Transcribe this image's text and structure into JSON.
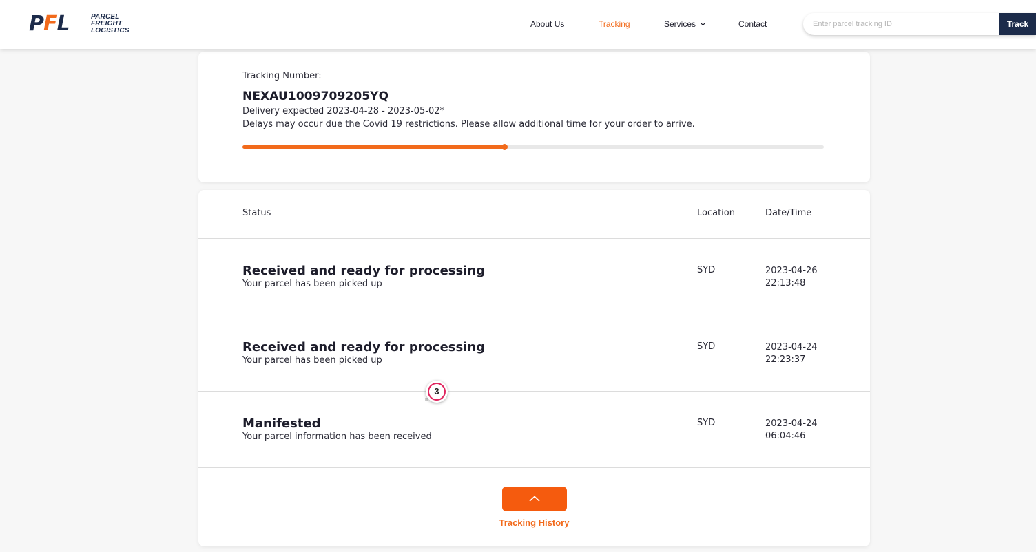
{
  "brand": {
    "logo_mark": "PFL",
    "logo_lines": [
      "PARCEL",
      "FREIGHT",
      "LOGISTICS"
    ],
    "accent_color": "#f26a1b",
    "navy_color": "#1c2b4a"
  },
  "nav": {
    "about": "About Us",
    "tracking": "Tracking",
    "services": "Services",
    "contact": "Contact",
    "active": "Tracking"
  },
  "search": {
    "placeholder": "Enter parcel tracking ID",
    "value": "",
    "button_label": "Track"
  },
  "summary": {
    "tracking_label": "Tracking Number:",
    "tracking_number": "NEXAU1009709205YQ",
    "expected": "Delivery expected 2023-04-28 - 2023-05-02*",
    "delay_notice": "Delays may occur due the Covid 19 restrictions. Please allow additional time for your order to arrive.",
    "progress_fraction": 0.45
  },
  "table": {
    "headers": {
      "status": "Status",
      "location": "Location",
      "datetime": "Date/Time"
    },
    "rows": [
      {
        "title": "Received and ready for processing",
        "subtitle": "Your parcel has been picked up",
        "location": "SYD",
        "date": "2023-04-26",
        "time": "22:13:48"
      },
      {
        "title": "Received and ready for processing",
        "subtitle": "Your parcel has been picked up",
        "location": "SYD",
        "date": "2023-04-24",
        "time": "22:23:37"
      },
      {
        "title": "Manifested",
        "subtitle": "Your parcel information has been received",
        "location": "SYD",
        "date": "2023-04-24",
        "time": "06:04:46"
      }
    ]
  },
  "history": {
    "label": "Tracking History",
    "icon": "chevron-up-icon"
  },
  "overlay_marker": {
    "label": "3"
  }
}
